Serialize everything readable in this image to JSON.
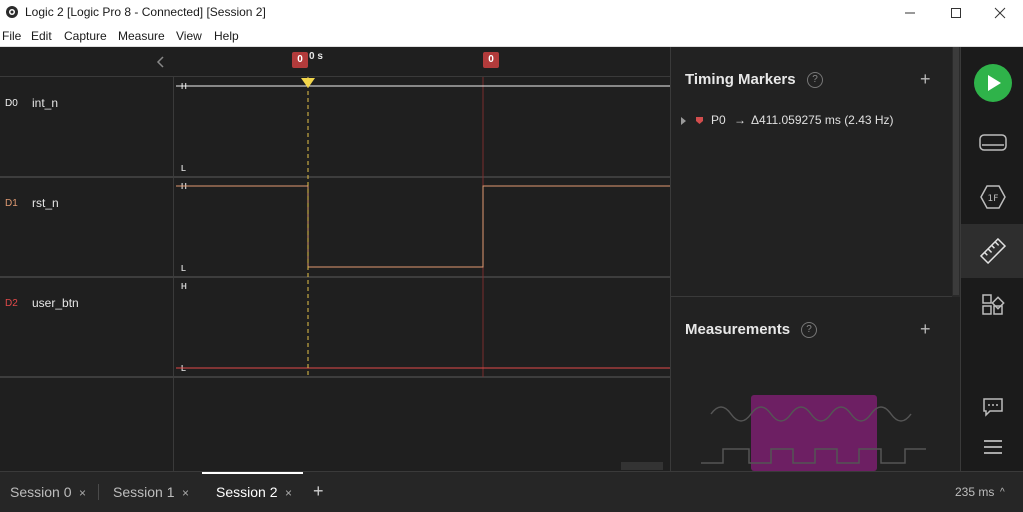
{
  "window": {
    "title": "Logic 2 [Logic Pro 8 - Connected] [Session 2]",
    "minimize_icon": "minimize-icon",
    "maximize_icon": "maximize-icon",
    "close_icon": "close-icon"
  },
  "menu": [
    "File",
    "Edit",
    "Capture",
    "Measure",
    "View",
    "Help"
  ],
  "ruler": {
    "marker0_label": "0",
    "time_label": "0 s",
    "marker1_label": "0"
  },
  "channels": [
    {
      "num": "D0",
      "name": "int_n",
      "color": "#f0f0f0",
      "high": "H",
      "low": "L"
    },
    {
      "num": "D1",
      "name": "rst_n",
      "color": "#e09a72",
      "high": "H",
      "low": "L"
    },
    {
      "num": "D2",
      "name": "user_btn",
      "color": "#e24a4a",
      "high": "H",
      "low": "L"
    }
  ],
  "timing_markers": {
    "title": "Timing Markers",
    "help": "?",
    "add": "+",
    "rows": [
      {
        "name": "P0",
        "arrow": "→",
        "value": "Δ411.059275 ms (2.43 Hz)"
      }
    ]
  },
  "measurements": {
    "title": "Measurements",
    "help": "?",
    "add": "+"
  },
  "sidebar": {
    "play_icon": "play-icon",
    "items": [
      "device-icon",
      "analyzer-1f-icon",
      "ruler-icon",
      "extensions-icon",
      "chat-icon",
      "menu-icon"
    ],
    "accent": "#2fb34a"
  },
  "tabs": [
    {
      "label": "Session 0",
      "close": "×"
    },
    {
      "label": "Session 1",
      "close": "×"
    },
    {
      "label": "Session 2",
      "close": "×"
    }
  ],
  "add_tab": "+",
  "zoom": {
    "label": "235 ms",
    "caret": "^"
  }
}
